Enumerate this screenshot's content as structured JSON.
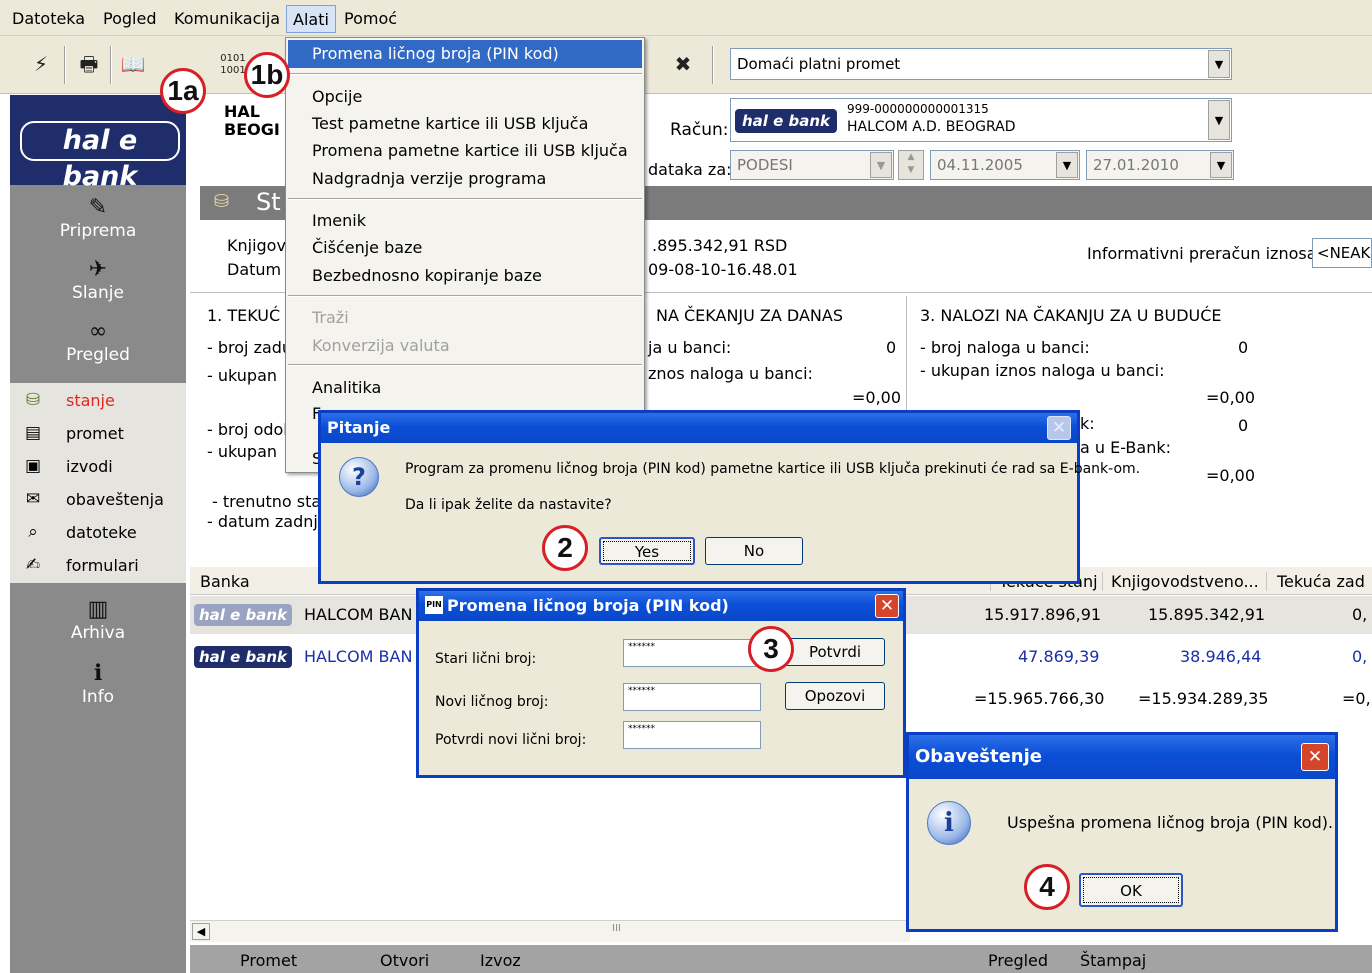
{
  "menubar": {
    "items": [
      "Datoteka",
      "Pogled",
      "Komunikacija",
      "Alati",
      "Pomoć"
    ]
  },
  "toolbar": {
    "transfer_type": "Domaći platni promet",
    "account_label": "Račun:",
    "account_number": "999-000000000001315",
    "account_owner": "HALCOM A.D. BEOGRAD",
    "data_for_label": "dataka za:",
    "data_for_value": "PODESI",
    "date_from": "04.11.2005",
    "date_to": "27.01.2010"
  },
  "sidebar": {
    "logo_text": "hal e bank",
    "big_items": [
      {
        "label": "Priprema",
        "icon": "pen-icon"
      },
      {
        "label": "Slanje",
        "icon": "paper-plane-icon"
      },
      {
        "label": "Pregled",
        "icon": "binoculars-icon"
      }
    ],
    "list_items": [
      {
        "label": "stanje",
        "icon": "coins-icon"
      },
      {
        "label": "promet",
        "icon": "ledger-icon"
      },
      {
        "label": "izvodi",
        "icon": "statement-icon"
      },
      {
        "label": "obaveštenja",
        "icon": "envelope-icon"
      },
      {
        "label": "datoteke",
        "icon": "magnifier-icon"
      },
      {
        "label": "formulari",
        "icon": "form-icon"
      }
    ],
    "bottom_items": [
      {
        "label": "Arhiva",
        "icon": "archive-icon"
      },
      {
        "label": "Info",
        "icon": "info-icon"
      }
    ]
  },
  "main": {
    "company_line1": "HAL",
    "company_line2": "BEOGI",
    "section_title": "St",
    "book_label": "Knjigov",
    "book_value": ".895.342,91 RSD",
    "date_label": "Datum",
    "date_value": "09-08-10-16.48.01",
    "info_calc_label": "Informativni preračun iznosa :",
    "info_calc_value": "<NEAK",
    "sec1_title": "1. TEKUĆ",
    "sec1_lines": [
      "- broj zadu",
      "- ukupan",
      "- broj odol",
      "- ukupan"
    ],
    "sec1_footer": [
      "- trenutno star",
      "- datum zadnje"
    ],
    "sec2_title": "NA ČEKANJU ZA DANAS",
    "sec2_line1": "ja u banci:",
    "sec2_line1_val": "0",
    "sec2_line2": "znos naloga u banci:",
    "sec2_line2_val": "=0,00",
    "sec3_title": "3. NALOZI NA ČAKANJU ZA U BUDUĆE",
    "sec3_line1": "- broj naloga u banci:",
    "sec3_line1_val": "0",
    "sec3_line2": "- ukupan iznos naloga u banci:",
    "sec3_line2_val": "=0,00",
    "sec3_line3": "k:",
    "sec3_line3_val": "0",
    "sec3_line4": "a u E-Bank:",
    "sec3_line4_val": "=0,00"
  },
  "grid": {
    "headers": [
      "Banka",
      "Tekuće stanje",
      "Knjigovodstveno...",
      "Tekuća zad"
    ],
    "rows": [
      {
        "bank": "HALCOM BAN",
        "current": "15.917.896,91",
        "book": "15.895.342,91",
        "extra": "0,"
      },
      {
        "bank": "HALCOM BAN",
        "current": "47.869,39",
        "book": "38.946,44",
        "extra": "0,"
      }
    ],
    "total": {
      "current": "=15.965.766,30",
      "book": "=15.934.289,35",
      "extra": "=0,"
    }
  },
  "bottombar": {
    "items": [
      "Promet",
      "Otvori",
      "Izvoz",
      "Pregled",
      "Štampaj"
    ]
  },
  "dropdown": {
    "items": [
      "Promena ličnog broja (PIN kod)",
      "Opcije",
      "Test pametne kartice ili USB ključa",
      "Promena pametne kartice ili USB ključa",
      "Nadgradnja verzije programa",
      "Imenik",
      "Čišćenje baze",
      "Bezbednosno kopiranje baze",
      "Traži",
      "Konverzija valuta",
      "Analitika",
      "F",
      "S"
    ]
  },
  "dialog_question": {
    "title": "Pitanje",
    "message1": "Program za promenu ličnog broja (PIN kod) pametne kartice ili USB ključa prekinuti će rad sa E-bank-om.",
    "message2": "Da li ipak želite da nastavite?",
    "yes": "Yes",
    "no": "No"
  },
  "dialog_pin": {
    "title": "Promena ličnog broja (PIN kod)",
    "title_icon": "PIN",
    "old_label": "Stari lični broj:",
    "new_label": "Novi ličnog broj:",
    "confirm_label": "Potvrdi novi lični broj:",
    "old_value": "******",
    "new_value": "******",
    "confirm_value": "******",
    "confirm_button": "Potvrdi",
    "cancel_button": "Opozovi"
  },
  "dialog_notice": {
    "title": "Obaveštenje",
    "message": "Uspešna promena ličnog broja (PIN kod).",
    "ok": "OK"
  },
  "callouts": [
    "1a",
    "1b",
    "2",
    "3",
    "4"
  ],
  "colors": {
    "accent_red": "#d71f26",
    "xp_blue": "#0b4fd8",
    "navy": "#1f2d6a",
    "sidebar_gray": "#8a8a8a"
  }
}
